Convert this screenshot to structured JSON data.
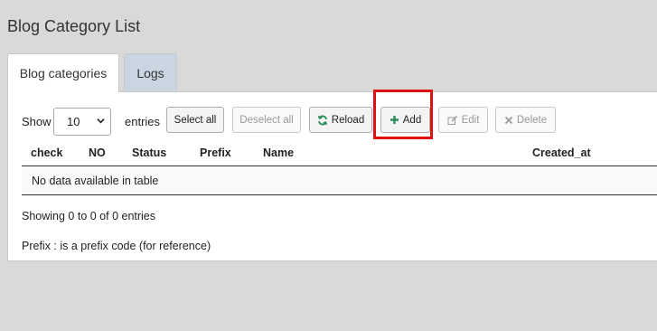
{
  "page": {
    "title": "Blog Category List"
  },
  "tabs": [
    {
      "label": "Blog categories",
      "active": true
    },
    {
      "label": "Logs",
      "active": false
    }
  ],
  "toolbar": {
    "show_label": "Show",
    "page_length": "10",
    "entries_label": "entries",
    "select_all": "Select all",
    "deselect_all": "Deselect all",
    "reload": "Reload",
    "add": "Add",
    "edit": "Edit",
    "delete": "Delete"
  },
  "table": {
    "columns": [
      "check",
      "NO",
      "Status",
      "Prefix",
      "Name",
      "Created_at"
    ],
    "empty_message": "No data available in table"
  },
  "footer": {
    "info": "Showing 0 to 0 of 0 entries",
    "note": "Prefix : is a prefix code (for reference)"
  },
  "colors": {
    "background": "#d9d9d9",
    "inactive_tab": "#c9d5e1",
    "highlight": "#dd1111",
    "reload_icon": "#2e8b57",
    "add_icon": "#2e8b57"
  },
  "icons": {
    "reload": "refresh-icon",
    "add": "plus-icon",
    "edit": "pencil-square-icon",
    "delete": "x-icon"
  }
}
